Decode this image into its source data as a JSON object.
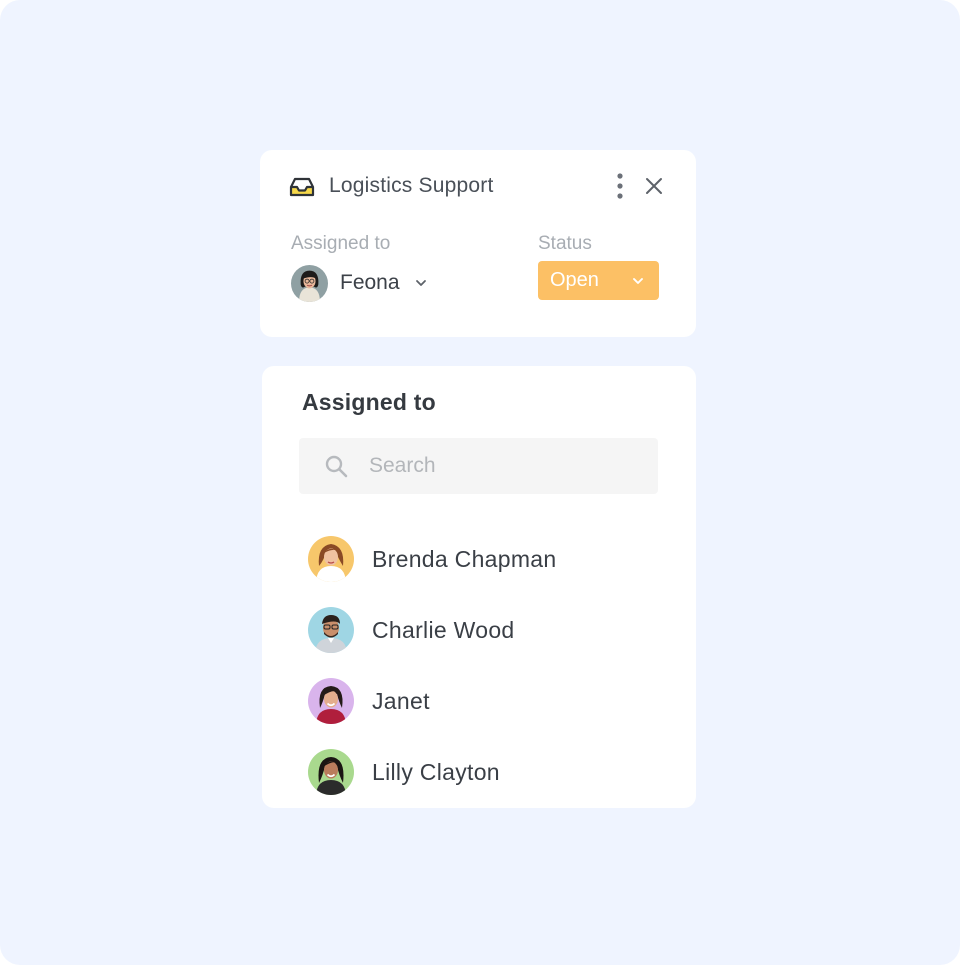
{
  "ticket": {
    "title": "Logistics Support",
    "inbox_icon": "inbox-icon",
    "more_icon": "more-vertical-icon",
    "close_icon": "close-icon",
    "assigned_label": "Assigned to",
    "assignee": "Feona",
    "status_label": "Status",
    "status_value": "Open",
    "status_color": "#fcc065"
  },
  "assign_panel": {
    "title": "Assigned to",
    "search_placeholder": "Search",
    "search_value": "",
    "users": [
      {
        "name": "Brenda Chapman",
        "avatar_bg": "#f7c76b"
      },
      {
        "name": "Charlie Wood",
        "avatar_bg": "#9fd6e4"
      },
      {
        "name": "Janet",
        "avatar_bg": "#d9b4ec"
      },
      {
        "name": "Lilly Clayton",
        "avatar_bg": "#a9d98e"
      }
    ]
  },
  "colors": {
    "background": "#eff4ff",
    "card": "#ffffff",
    "accent": "#fcc065"
  }
}
